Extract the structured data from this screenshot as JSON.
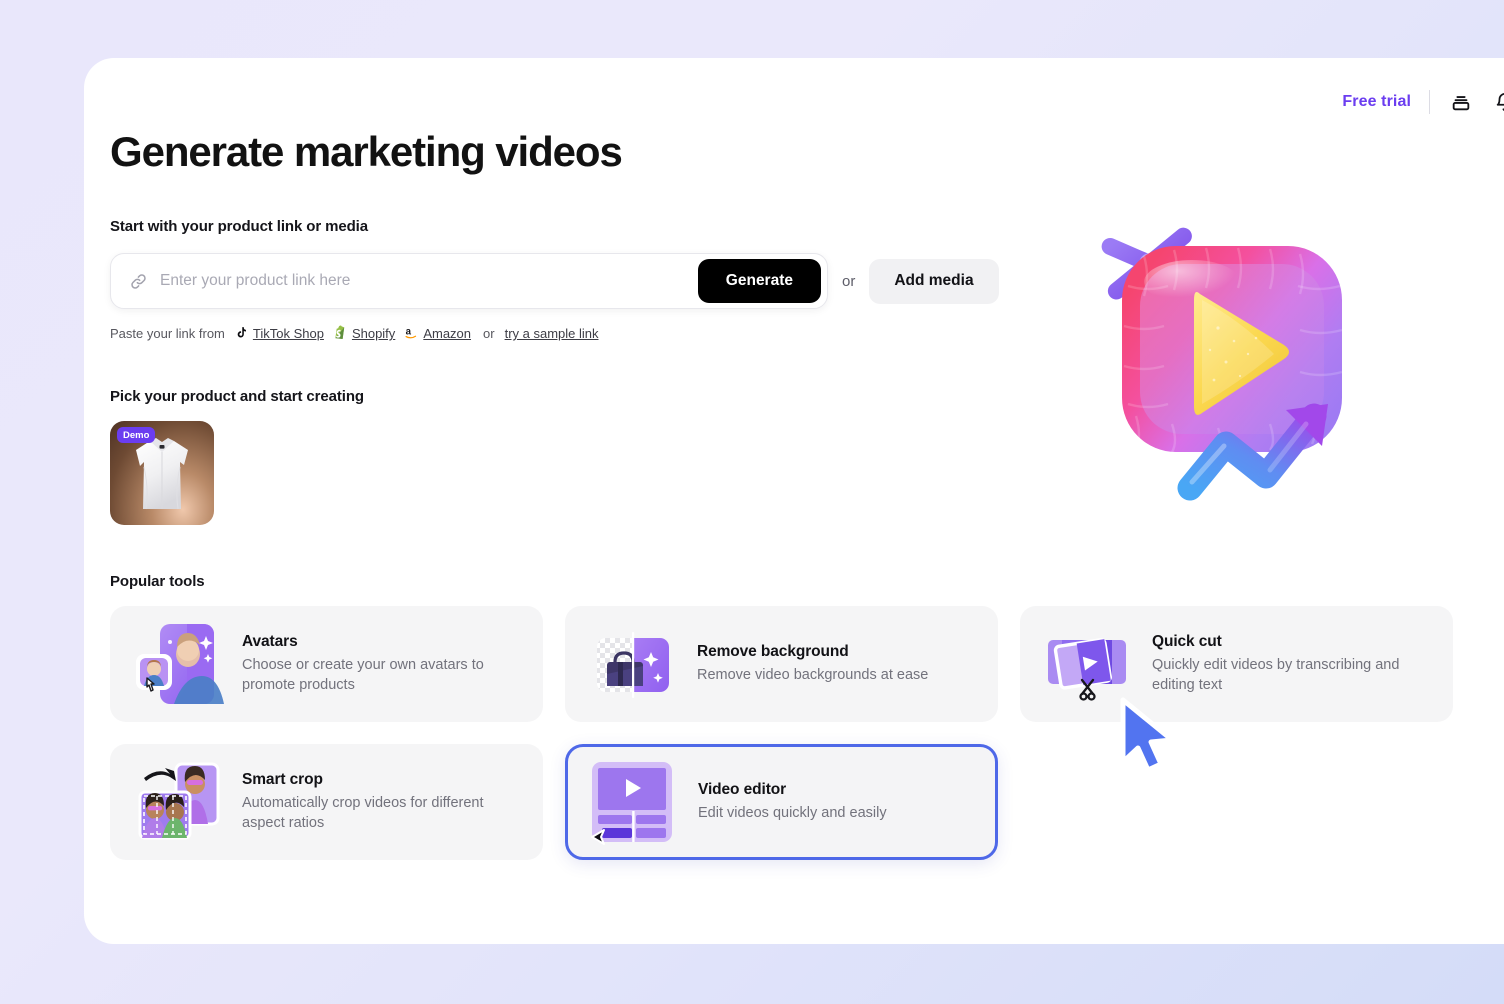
{
  "header": {
    "free_trial_label": "Free trial",
    "credits_icon": "stacked-credits-icon",
    "notifications_icon": "bell-icon"
  },
  "page": {
    "title": "Generate marketing videos"
  },
  "link_section": {
    "label": "Start with your product link or media",
    "input_placeholder": "Enter your product link here",
    "input_value": "",
    "link_icon": "chain-link-icon",
    "generate_label": "Generate",
    "or_label": "or",
    "add_media_label": "Add media",
    "paste_prefix": "Paste your link from",
    "sources": [
      {
        "label": "TikTok Shop",
        "icon": "tiktok-icon"
      },
      {
        "label": "Shopify",
        "icon": "shopify-icon"
      },
      {
        "label": "Amazon",
        "icon": "amazon-icon"
      }
    ],
    "paste_or": "or",
    "sample_link_label": "try a sample link"
  },
  "product_section": {
    "label": "Pick your product and start creating",
    "products": [
      {
        "badge": "Demo",
        "alt": "white-dress-shirt"
      }
    ]
  },
  "tools_section": {
    "label": "Popular tools",
    "tools": [
      {
        "title": "Avatars",
        "desc": "Choose or create your own avatars to promote products",
        "icon": "avatars-icon",
        "selected": false
      },
      {
        "title": "Remove background",
        "desc": "Remove video backgrounds at ease",
        "icon": "remove-background-icon",
        "selected": false
      },
      {
        "title": "Quick cut",
        "desc": "Quickly edit videos by transcribing and editing text",
        "icon": "quick-cut-icon",
        "selected": false
      },
      {
        "title": "Smart crop",
        "desc": "Automatically crop videos for different aspect ratios",
        "icon": "smart-crop-icon",
        "selected": false
      },
      {
        "title": "Video editor",
        "desc": "Edit videos quickly and easily",
        "icon": "video-editor-icon",
        "selected": true
      }
    ]
  },
  "colors": {
    "accent_purple": "#6b3df0",
    "selection_blue": "#4e68e8",
    "cursor_blue": "#5274f0",
    "card_bg": "#f5f5f6",
    "button_black": "#000000"
  },
  "illustration": {
    "name": "3d-play-button-with-sparkle-and-growth-arrow"
  }
}
